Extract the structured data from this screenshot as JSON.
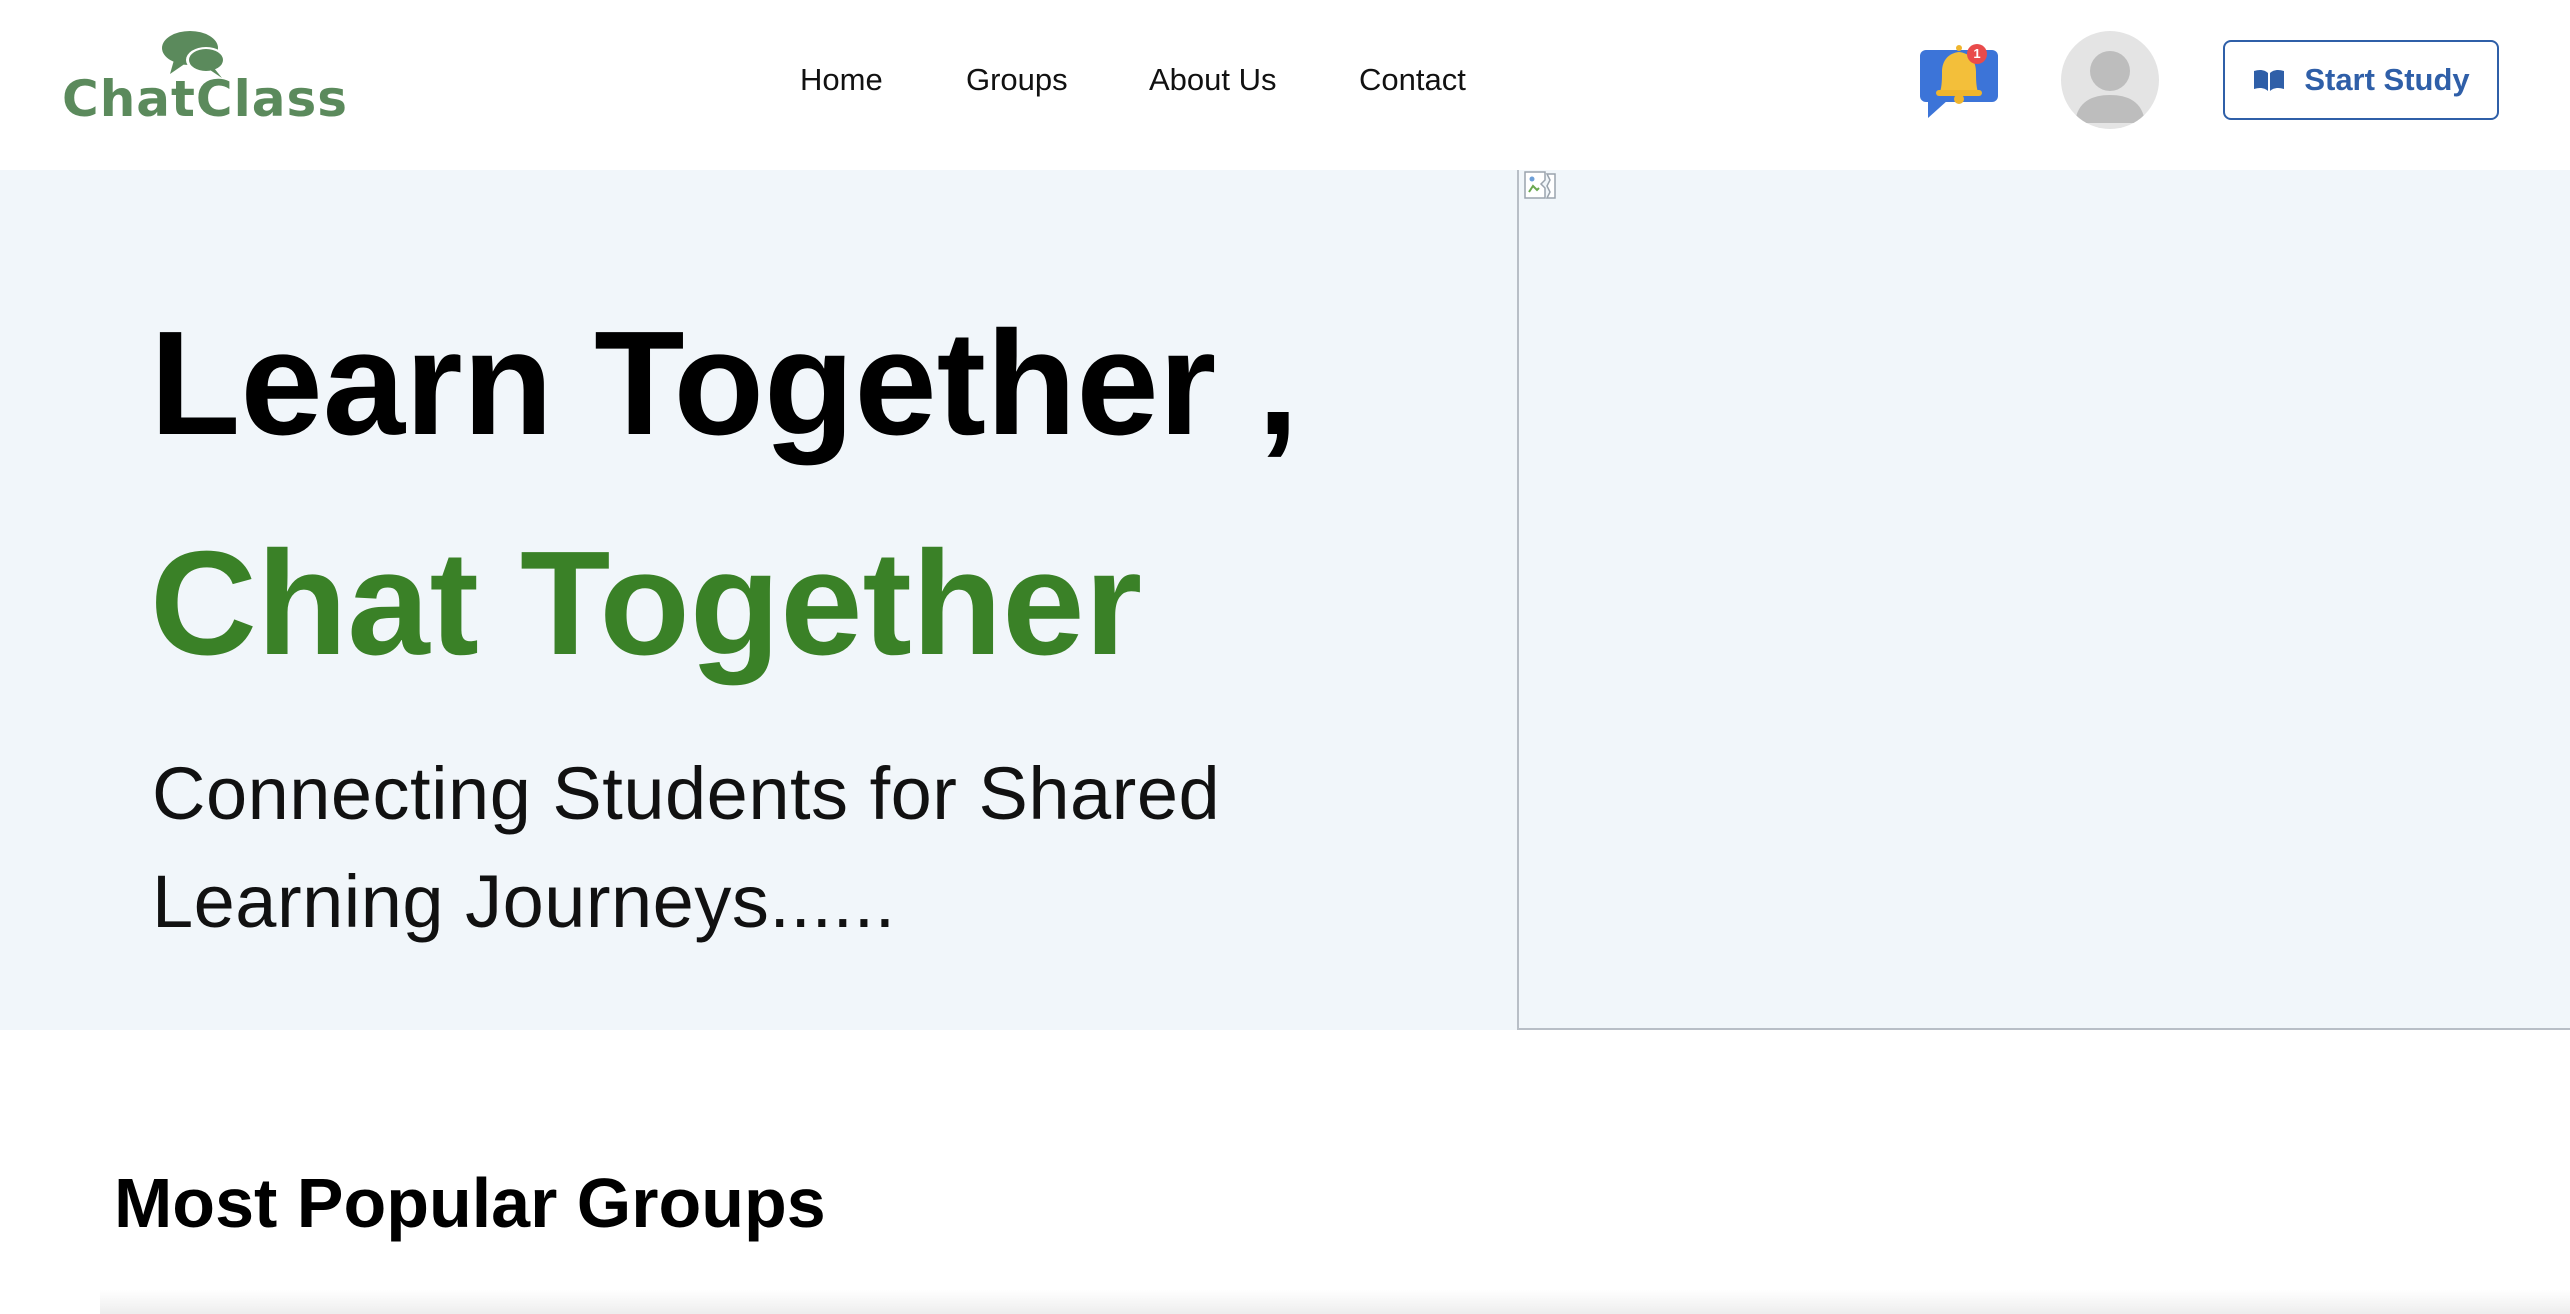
{
  "brand": {
    "name": "ChatClass",
    "logo_icon": "chat-bubbles-icon",
    "color": "#5b8a5c"
  },
  "nav": {
    "items": [
      {
        "label": "Home"
      },
      {
        "label": "Groups"
      },
      {
        "label": "About Us"
      },
      {
        "label": "Contact"
      }
    ]
  },
  "header_actions": {
    "notification_icon": "bell-chat-icon",
    "notification_count": "1",
    "avatar_icon": "user-avatar-icon",
    "start_button_label": "Start Study",
    "start_button_icon": "open-book-icon",
    "accent_color": "#2f5fa8"
  },
  "hero": {
    "title_line1": "Learn Together ,",
    "title_line2": "Chat Together",
    "subtitle": "Connecting Students for Shared Learning Journeys......",
    "title_accent_color": "#3a8127",
    "background_color": "#f1f6fa",
    "image_icon": "broken-image-icon"
  },
  "popular": {
    "title": "Most Popular Groups"
  }
}
